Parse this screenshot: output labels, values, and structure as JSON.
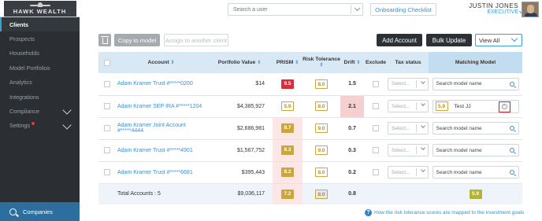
{
  "brand": {
    "logo_text": "HAWK WEALTH"
  },
  "sidebar": {
    "items": [
      {
        "label": "Clients",
        "active": true
      },
      {
        "label": "Prospects"
      },
      {
        "label": "Households"
      },
      {
        "label": "Model Portfolios"
      },
      {
        "label": "Analytics"
      },
      {
        "label": "Integrations"
      },
      {
        "label": "Compliance",
        "expandable": true
      },
      {
        "label": "Settings",
        "expandable": true,
        "notification_dot": true
      }
    ],
    "companies_label": "Companies"
  },
  "header": {
    "search_placeholder": "Search a user",
    "onboarding_label": "Onboarding Checklist",
    "user_name": "JUSTIN JONES",
    "user_role": "EXECUTIVE"
  },
  "toolbar": {
    "copy_label": "Copy to model",
    "assign_label": "Assign to another client",
    "add_account_label": "Add Account",
    "bulk_update_label": "Bulk Update",
    "view_label": "View All"
  },
  "table": {
    "headers": {
      "account": "Account",
      "portfolio_value": "Portfolio Value",
      "prism": "PRISM",
      "risk_tolerance": "Risk Tolerance",
      "drift": "Drift",
      "exclude": "Exclude",
      "tax_status": "Tax status",
      "matching_model": "Matching Model"
    },
    "sort_glyph": "⇕",
    "rows": [
      {
        "account": "Adam Kramer Trust #*****0200",
        "value": "$14",
        "prism": "9.5",
        "prism_style": "red",
        "risk": "8.0",
        "drift": "1.5",
        "drift_hl": false,
        "tax": "Select...",
        "model_placeholder": "Search model name"
      },
      {
        "account": "Adam Kramer SEP IRA #*****1204",
        "value": "$4,385,927",
        "prism": "5.9",
        "prism_style": "outline",
        "risk": "8.0",
        "drift": "2.1",
        "drift_hl": true,
        "tax": "Select...",
        "model_selected": true,
        "model_score": "5.9",
        "model_name": "Test JJ"
      },
      {
        "account": "Adam Kramer Joint Account #*****4444",
        "value": "$2,686,981",
        "prism": "8.7",
        "prism_style": "yellow",
        "risk": "9.0",
        "drift": "0.7",
        "drift_hl": false,
        "tax": "Select...",
        "model_placeholder": "Search model name"
      },
      {
        "account": "Adam Kramer Trust #*****4901",
        "value": "$1,567,752",
        "prism": "8.3",
        "prism_style": "yellow",
        "risk": "9.0",
        "drift": "0.3",
        "drift_hl": false,
        "tax": "Select...",
        "model_placeholder": "Search model name"
      },
      {
        "account": "Adam Kramer Trust #*****6681",
        "value": "$395,443",
        "prism": "8.2",
        "prism_style": "yellow",
        "risk": "8.0",
        "drift": "0.2",
        "drift_hl": false,
        "tax": "Select...",
        "model_placeholder": "Search model name"
      }
    ],
    "total": {
      "label": "Total Accounts : 5",
      "value": "$9,036,117",
      "prism": "7.2",
      "risk": "8.0",
      "drift": "0.8",
      "model_score": "5.9"
    }
  },
  "help_text": "How the risk tolerance scores are mapped to the investment goals",
  "colors": {
    "sidebar_bg": "#2b2f33",
    "accent": "#3a8fce",
    "header_row": "#d8e8f5",
    "prism_red": "#d62f3a",
    "prism_yellow": "#c9a63e"
  }
}
